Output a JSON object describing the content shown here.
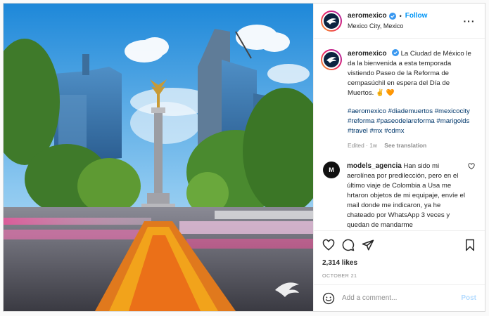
{
  "post": {
    "account": "aeromexico",
    "follow_label": "Follow",
    "dot": "•",
    "location": "Mexico City, Mexico",
    "more_label": "···",
    "caption": "La Ciudad de México le da la bienvenida a esta temporada vistiendo Paseo de la Reforma de cempasúchil en espera del Día de Muertos. ✌️ 🧡",
    "hashtags": "#aeromexico #diademuertos #mexicocity #reforma #paseodelareforma #marigolds #travel #mx #cdmx",
    "edited_label": "Edited · 1w",
    "see_translation_label": "See translation",
    "likes": "2,314 likes",
    "date": "OCTOBER 21"
  },
  "comment": {
    "username": "models_agencia",
    "avatar_initials": "M",
    "text": "Han sido mi aerolínea por predilección, pero en el último viaje de Colombia a Usa me hrtaron objetos de mi equipaje, envíe el mail donde me indicaron, ya he chateado por WhatsApp 3 veces y quedan de mandarme"
  },
  "add_comment": {
    "placeholder": "Add a comment...",
    "post_label": "Post"
  },
  "icons": {
    "verified": "verified-badge-icon",
    "like": "heart-icon",
    "comment": "comment-bubble-icon",
    "share": "paper-plane-icon",
    "save": "bookmark-icon",
    "emoji": "smiley-icon",
    "logo": "aeromexico-eagle-icon"
  },
  "colors": {
    "link_blue": "#0095f6",
    "hashtag": "#00376b",
    "muted": "#8e8e8e",
    "post_disabled": "#b3dbff"
  }
}
